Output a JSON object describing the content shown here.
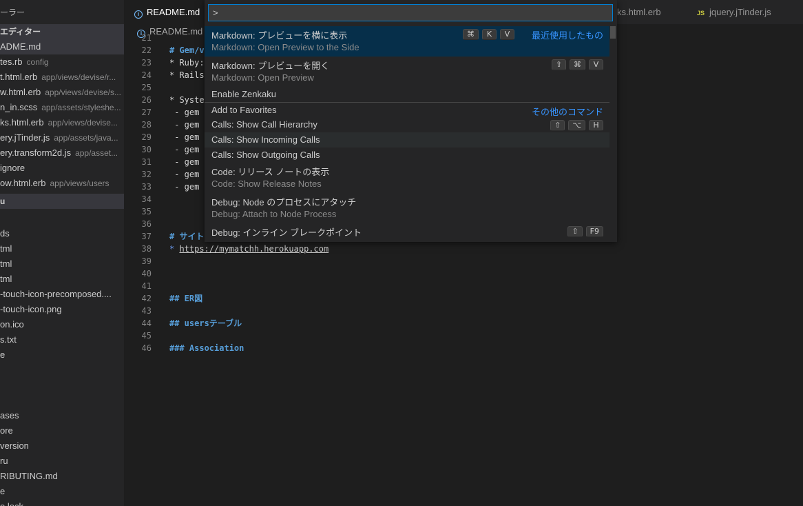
{
  "sidebar": {
    "header": "ーラー",
    "open_editors_label": "エディター",
    "open_editors": [
      {
        "name": "ADME.md",
        "path": "",
        "active": true
      },
      {
        "name": "tes.rb",
        "path": "config"
      },
      {
        "name": "t.html.erb",
        "path": "app/views/devise/r..."
      },
      {
        "name": "w.html.erb",
        "path": "app/views/devise/s..."
      },
      {
        "name": "n_in.scss",
        "path": "app/assets/styleshe..."
      },
      {
        "name": "ks.html.erb",
        "path": "app/views/devise..."
      },
      {
        "name": "ery.jTinder.js",
        "path": "app/assets/java..."
      },
      {
        "name": "ery.transform2d.js",
        "path": "app/asset..."
      },
      {
        "name": "ignore",
        "path": ""
      },
      {
        "name": "ow.html.erb",
        "path": "app/views/users"
      }
    ],
    "folder_label": "u",
    "files": [
      "ds",
      "tml",
      "tml",
      "tml",
      "-touch-icon-precomposed....",
      "-touch-icon.png",
      "on.ico",
      "s.txt",
      "e",
      "",
      "",
      "",
      "ases",
      "ore",
      "version",
      "ru",
      "RIBUTING.md",
      "e",
      "e.lock"
    ]
  },
  "tabs": [
    {
      "label": "README.md",
      "icon": "info-icon",
      "active": true
    },
    {
      "label": "ks.html.erb",
      "icon": "",
      "active": false
    },
    {
      "label": "jquery.jTinder.js",
      "icon": "js-icon",
      "active": false
    }
  ],
  "breadcrumb": {
    "file": "README.md"
  },
  "editor": {
    "lines": [
      {
        "n": "21",
        "text": "",
        "kind": "plain"
      },
      {
        "n": "22",
        "text": "# Gem/v",
        "kind": "head"
      },
      {
        "n": "23",
        "text": "* Ruby:",
        "kind": "bullet"
      },
      {
        "n": "24",
        "text": "* Rails",
        "kind": "bullet"
      },
      {
        "n": "25",
        "text": "",
        "kind": "plain"
      },
      {
        "n": "26",
        "text": "* Syste",
        "kind": "bullet"
      },
      {
        "n": "27",
        "text": " - gem",
        "kind": "dash"
      },
      {
        "n": "28",
        "text": " - gem",
        "kind": "dash"
      },
      {
        "n": "29",
        "text": " - gem",
        "kind": "dash"
      },
      {
        "n": "30",
        "text": " - gem",
        "kind": "dash"
      },
      {
        "n": "31",
        "text": " - gem",
        "kind": "dash"
      },
      {
        "n": "32",
        "text": " - gem",
        "kind": "dash"
      },
      {
        "n": "33",
        "text": " - gem",
        "kind": "dash"
      },
      {
        "n": "34",
        "text": "",
        "kind": "plain"
      },
      {
        "n": "35",
        "text": "",
        "kind": "plain"
      },
      {
        "n": "36",
        "text": "",
        "kind": "plain"
      },
      {
        "n": "37",
        "text": "# サイトU",
        "kind": "head"
      },
      {
        "n": "38",
        "text": "https://mymatchh.herokuapp.com",
        "kind": "link"
      },
      {
        "n": "39",
        "text": "",
        "kind": "plain"
      },
      {
        "n": "40",
        "text": "",
        "kind": "plain"
      },
      {
        "n": "41",
        "text": "",
        "kind": "plain"
      },
      {
        "n": "42",
        "text": "## ER図",
        "kind": "head"
      },
      {
        "n": "43",
        "text": "",
        "kind": "plain"
      },
      {
        "n": "44",
        "text": "## usersテーブル",
        "kind": "head"
      },
      {
        "n": "45",
        "text": "",
        "kind": "plain"
      },
      {
        "n": "46",
        "text": "### Association",
        "kind": "head"
      }
    ]
  },
  "palette": {
    "input_value": ">",
    "items": [
      {
        "label": "Markdown: プレビューを横に表示",
        "sub": "Markdown: Open Preview to the Side",
        "keys": [
          "⌘",
          "K",
          "V"
        ],
        "right": "最近使用したもの",
        "state": "selected"
      },
      {
        "label": "Markdown: プレビューを開く",
        "sub": "Markdown: Open Preview",
        "keys": [
          "⇧",
          "⌘",
          "V"
        ],
        "right": "",
        "state": ""
      },
      {
        "label": "Enable Zenkaku",
        "sub": "",
        "keys": [],
        "right": "",
        "state": ""
      },
      {
        "label": "Add to Favorites",
        "sub": "",
        "keys": [],
        "right": "その他のコマンド",
        "state": "sep"
      },
      {
        "label": "Calls: Show Call Hierarchy",
        "sub": "",
        "keys": [
          "⇧",
          "⌥",
          "H"
        ],
        "right": "",
        "state": ""
      },
      {
        "label": "Calls: Show Incoming Calls",
        "sub": "",
        "keys": [],
        "right": "",
        "state": "hover"
      },
      {
        "label": "Calls: Show Outgoing Calls",
        "sub": "",
        "keys": [],
        "right": "",
        "state": ""
      },
      {
        "label": "Code: リリース ノートの表示",
        "sub": "Code: Show Release Notes",
        "keys": [],
        "right": "",
        "state": ""
      },
      {
        "label": "Debug: Node のプロセスにアタッチ",
        "sub": "Debug: Attach to Node Process",
        "keys": [],
        "right": "",
        "state": ""
      },
      {
        "label": "Debug: インライン ブレークポイント",
        "sub": "",
        "keys": [
          "⇧",
          "F9"
        ],
        "right": "",
        "state": ""
      }
    ]
  },
  "colors": {
    "accent": "#007fd4",
    "selection": "#062f4a",
    "link": "#3794ff"
  }
}
